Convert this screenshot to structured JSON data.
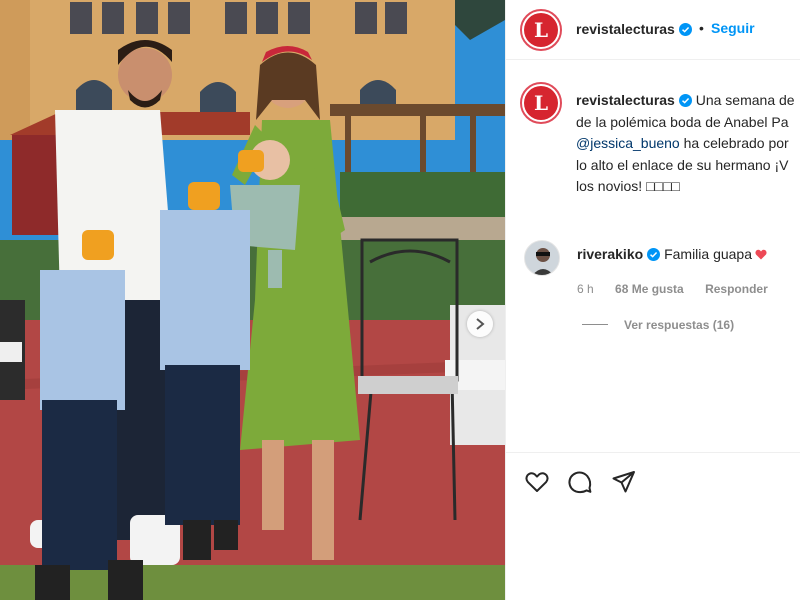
{
  "header": {
    "username": "revistalecturas",
    "separator": "•",
    "follow_label": "Seguir",
    "logo_letter": "L"
  },
  "caption": {
    "username": "revistalecturas",
    "line1": "Una semana de",
    "line2": "de la polémica boda de Anabel Pa",
    "mention": "@jessica_bueno",
    "line3_rest": " ha celebrado por",
    "line4": "lo alto el enlace de su hermano ¡V",
    "line5": "los novios! □□□□"
  },
  "comment": {
    "username": "riverakiko",
    "text": "Familia guapa",
    "time": "6 h",
    "likes": "68 Me gusta",
    "reply_label": "Responder"
  },
  "view_replies_label": "Ver respuestas (16)",
  "actions": {
    "like_icon": "heart-outline-icon",
    "comment_icon": "comment-bubble-icon",
    "share_icon": "paper-plane-icon"
  },
  "colors": {
    "accent_blue": "#0095f6",
    "mention_blue": "#00376b",
    "logo_red": "#d6252f",
    "heart_red": "#ed4956"
  }
}
